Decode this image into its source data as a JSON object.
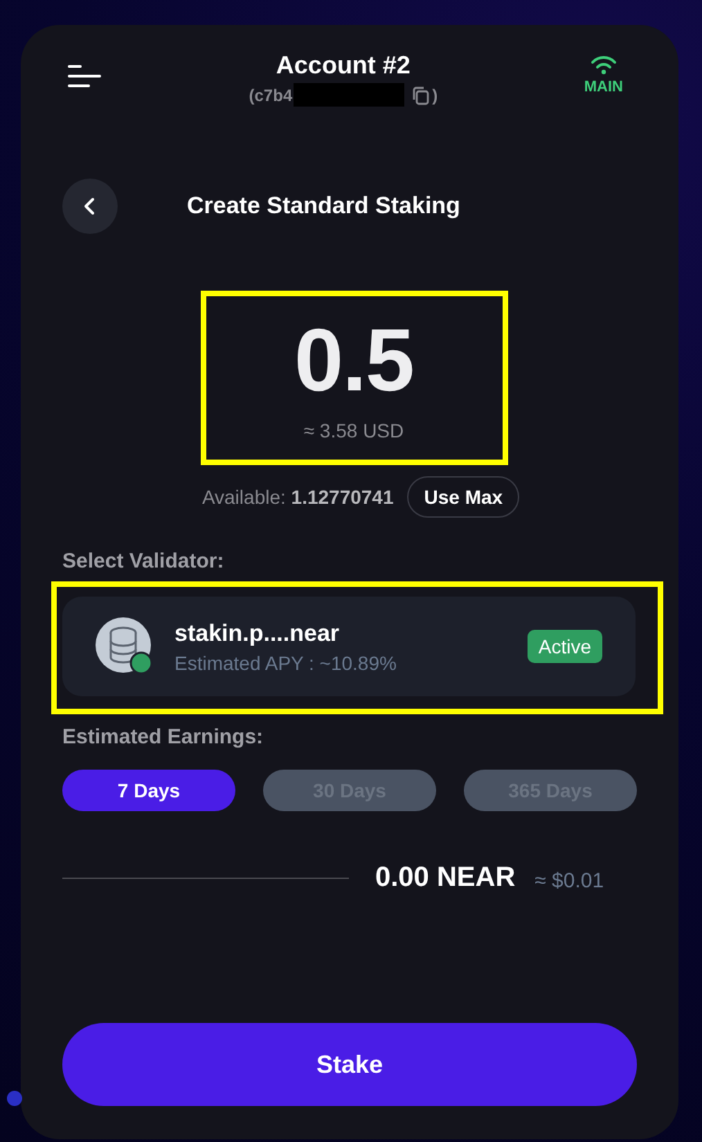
{
  "header": {
    "title": "Account #2",
    "address_start": "(c7b4",
    "address_redacted": true,
    "address_end": ")",
    "network": "MAIN"
  },
  "page_title": "Create Standard Staking",
  "amount": {
    "value": "0.5",
    "fiat": "≈ 3.58 USD",
    "highlighted": true
  },
  "available": {
    "text": "Available: **1.12770741**",
    "button": "Use Max"
  },
  "validator_label": "Select Validator:",
  "validator": {
    "name": "stakin.p....near",
    "apy": "Estimated APY : ~10.89%",
    "status": "Active",
    "highlighted": true
  },
  "earnings_label": "Estimated Earnings:",
  "periods": [
    {
      "label": "7 Days",
      "selected": true
    },
    {
      "label": "30 Days",
      "selected": false
    },
    {
      "label": "365 Days",
      "selected": false
    }
  ],
  "estimate": {
    "amount": "0.00 NEAR",
    "fiat": "≈ $0.01"
  },
  "action": "Stake"
}
